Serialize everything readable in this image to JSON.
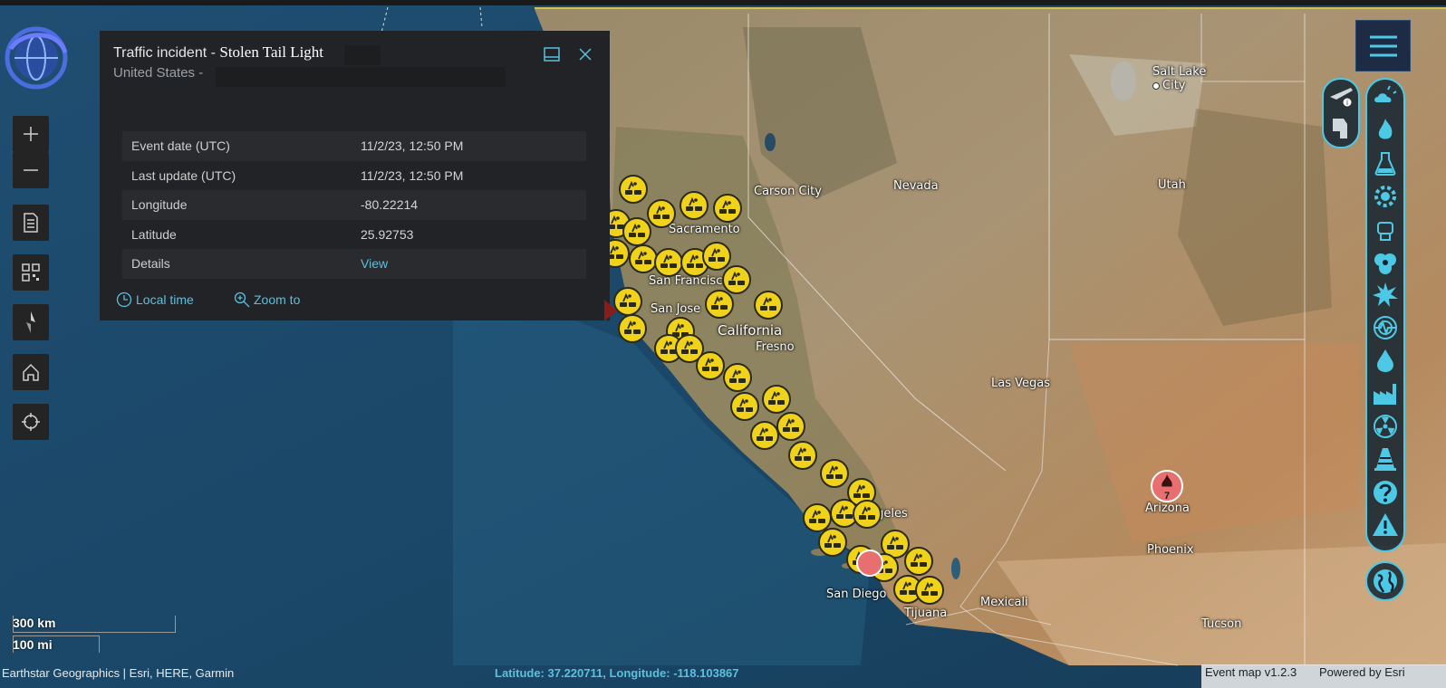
{
  "popup": {
    "title_prefix": "Traffic incident - ",
    "title_event": "Stolen  Tail  Light",
    "subtitle": "United States -",
    "rows": [
      {
        "label": "Event date (UTC)",
        "value": "11/2/23, 12:50 PM"
      },
      {
        "label": "Last update (UTC)",
        "value": "11/2/23, 12:50 PM"
      },
      {
        "label": "Longitude",
        "value": "-80.22214"
      },
      {
        "label": "Latitude",
        "value": "25.92753"
      },
      {
        "label": "Details",
        "value": "View"
      }
    ],
    "local_time_label": "Local time",
    "zoom_to_label": "Zoom to"
  },
  "places": [
    {
      "name": "Salt Lake\nCity",
      "key": "salt_lake"
    },
    {
      "name": "Carson City",
      "key": "carson"
    },
    {
      "name": "Nevada",
      "key": "nevada"
    },
    {
      "name": "Utah",
      "key": "utah"
    },
    {
      "name": "Sacramento",
      "key": "sacramento"
    },
    {
      "name": "San Francisco",
      "key": "sf"
    },
    {
      "name": "San Jose",
      "key": "sj"
    },
    {
      "name": "California",
      "key": "california"
    },
    {
      "name": "Fresno",
      "key": "fresno"
    },
    {
      "name": "Las Vegas",
      "key": "lasvegas"
    },
    {
      "name": "Angeles",
      "key": "la"
    },
    {
      "name": "Arizona",
      "key": "arizona"
    },
    {
      "name": "Phoenix",
      "key": "phoenix"
    },
    {
      "name": "San Diego",
      "key": "sandiego"
    },
    {
      "name": "Tijuana",
      "key": "tijuana"
    },
    {
      "name": "Mexicali",
      "key": "mexicali"
    },
    {
      "name": "Tucson",
      "key": "tucson"
    }
  ],
  "cluster": {
    "count": "7"
  },
  "scale": {
    "km": "300 km",
    "mi": "100 mi"
  },
  "footer": {
    "attribution": "Earthstar Geographics | Esri, HERE, Garmin",
    "coordinates": "Latitude: 37.220711, Longitude: -118.103867",
    "version": "Event map v1.2.3",
    "powered": "Powered by Esri"
  },
  "icons": {
    "left_toolbar": [
      "plus-icon",
      "minus-icon",
      "document-icon",
      "qr-code-icon",
      "compass-icon",
      "home-icon",
      "locate-icon"
    ],
    "right_panel": [
      "weather-icon",
      "fire-icon",
      "chemical-icon",
      "gear-icon",
      "fist-icon",
      "biohazard-icon",
      "explosion-icon",
      "earthquake-icon",
      "drop-icon",
      "factory-icon",
      "radiation-icon",
      "traffic-cone-icon",
      "question-icon",
      "warning-icon"
    ],
    "top_right": [
      "airplane-info-icon",
      "vehicle-icon",
      "menu-icon",
      "globe-icon"
    ]
  },
  "colors": {
    "accent": "#4dc9e6",
    "marker": "#f1d21a",
    "cluster": "#e86f6f",
    "popup_bg": "#222326",
    "link": "#5bc0de"
  }
}
